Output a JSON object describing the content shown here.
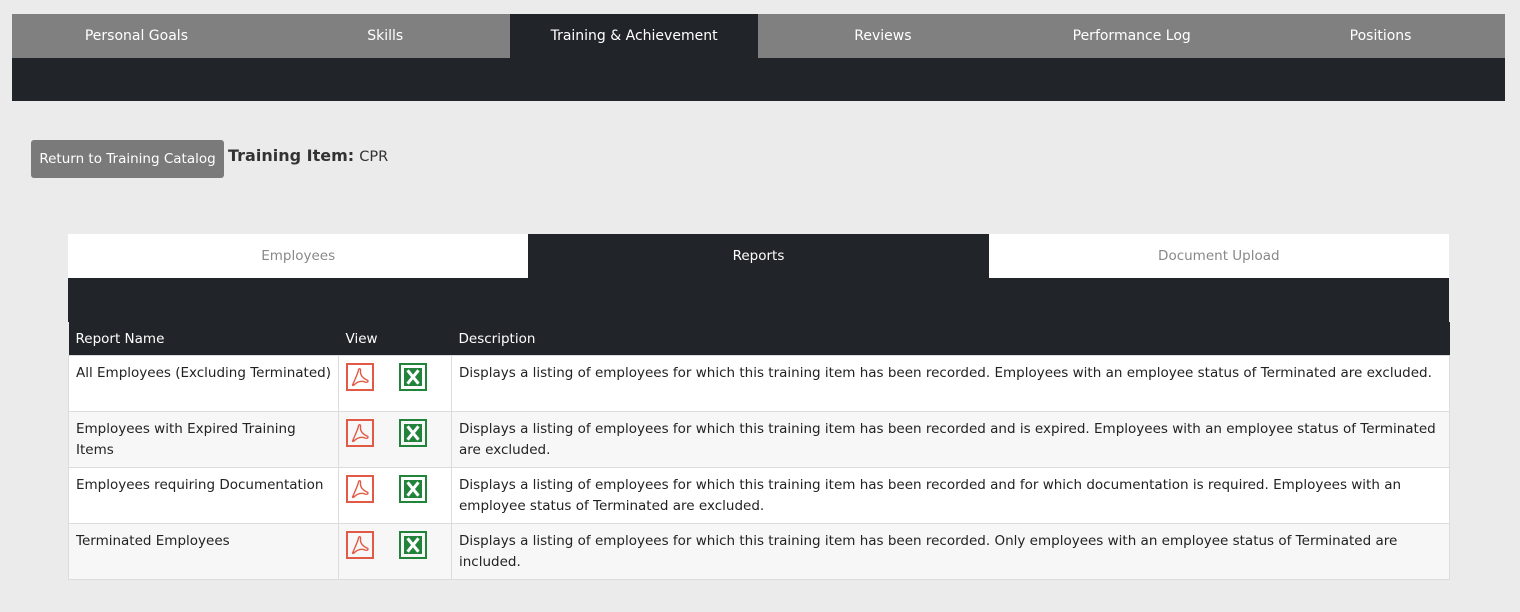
{
  "top_nav": {
    "tabs": [
      {
        "label": "Personal Goals",
        "active": false
      },
      {
        "label": "Skills",
        "active": false
      },
      {
        "label": "Training & Achievement",
        "active": true
      },
      {
        "label": "Reviews",
        "active": false
      },
      {
        "label": "Performance Log",
        "active": false
      },
      {
        "label": "Positions",
        "active": false
      }
    ]
  },
  "header": {
    "return_button_label": "Return to Training Catalog",
    "item_label": "Training Item:",
    "item_value": "CPR"
  },
  "sub_tabs": [
    {
      "label": "Employees",
      "active": false
    },
    {
      "label": "Reports",
      "active": true
    },
    {
      "label": "Document Upload",
      "active": false
    }
  ],
  "table": {
    "columns": [
      "Report Name",
      "View",
      "Description"
    ],
    "rows": [
      {
        "name": "All Employees (Excluding Terminated)",
        "description": "Displays a listing of employees for which this training item has been recorded. Employees with an employee status of Terminated are excluded."
      },
      {
        "name": "Employees with Expired Training Items",
        "description": "Displays a listing of employees for which this training item has been recorded and is expired. Employees with an employee status of Terminated are excluded."
      },
      {
        "name": "Employees requiring Documentation",
        "description": "Displays a listing of employees for which this training item has been recorded and for which documentation is required. Employees with an employee status of Terminated are excluded."
      },
      {
        "name": "Terminated Employees",
        "description": "Displays a listing of employees for which this training item has been recorded. Only employees with an employee status of Terminated are included."
      }
    ],
    "view_icons": [
      "pdf-icon",
      "excel-icon"
    ]
  },
  "colors": {
    "nav_gray": "#808080",
    "dark": "#212428",
    "pdf_red": "#e05a47",
    "excel_green": "#22843b",
    "page_bg": "#ebebeb"
  }
}
